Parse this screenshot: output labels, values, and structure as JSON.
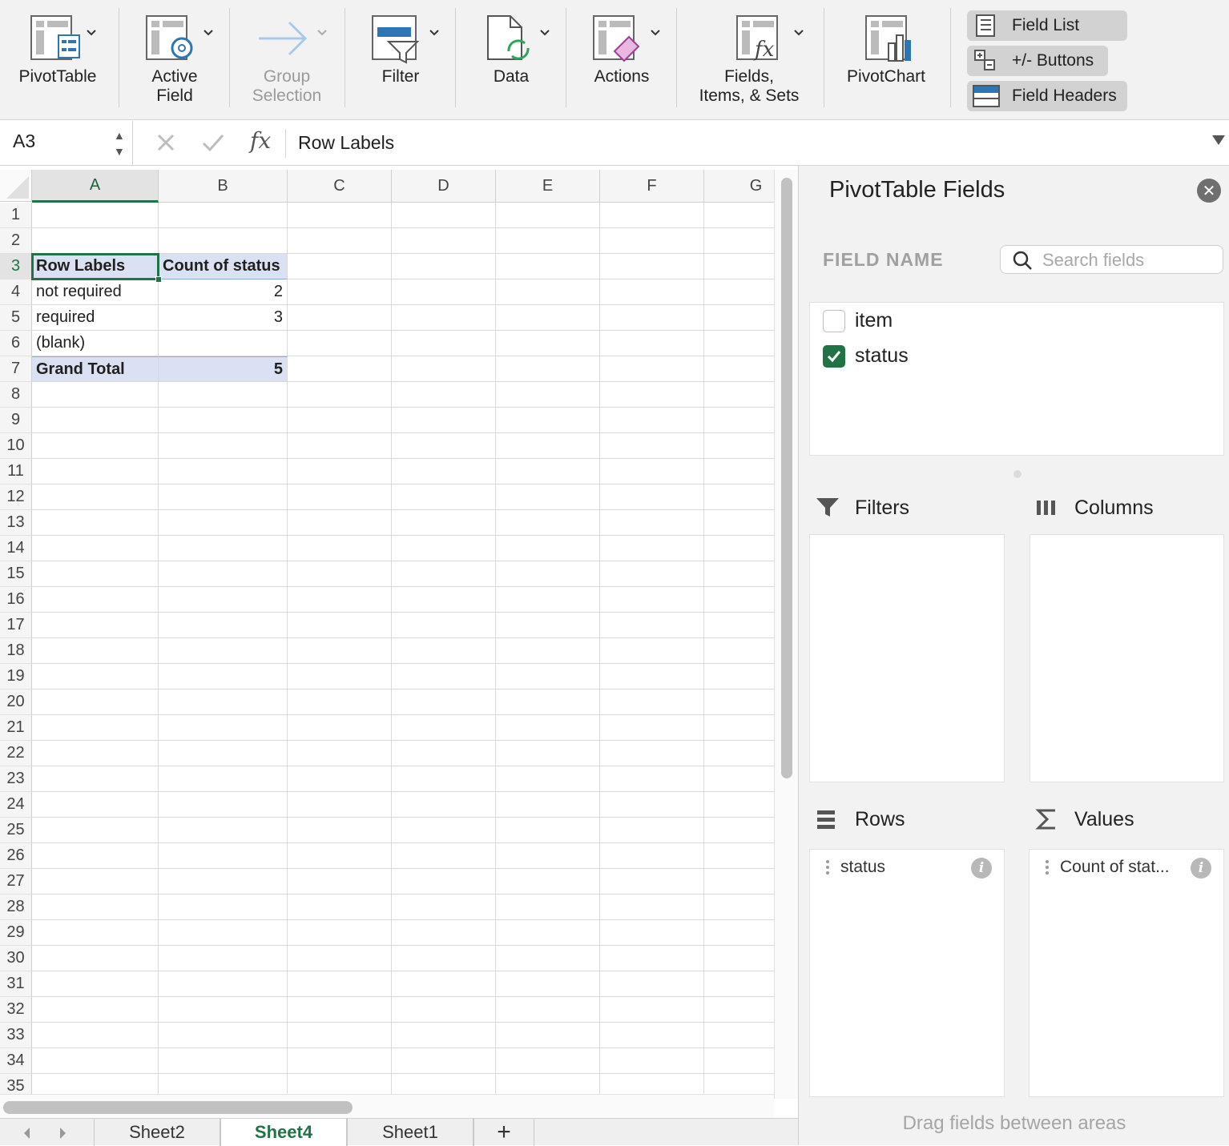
{
  "ribbon": {
    "pivottable": "PivotTable",
    "active_field_1": "Active",
    "active_field_2": "Field",
    "group_1": "Group",
    "group_2": "Selection",
    "filter": "Filter",
    "data": "Data",
    "actions": "Actions",
    "fields_1": "Fields,",
    "fields_2": "Items, & Sets",
    "pivotchart": "PivotChart",
    "field_list": "Field List",
    "buttons": "+/- Buttons",
    "field_headers": "Field Headers"
  },
  "formula_bar": {
    "cell_ref": "A3",
    "fx": "fx",
    "value": "Row Labels"
  },
  "grid": {
    "columns": [
      "A",
      "B",
      "C",
      "D",
      "E",
      "F",
      "G"
    ],
    "rows": [
      "1",
      "2",
      "3",
      "4",
      "5",
      "6",
      "7",
      "8",
      "9",
      "10",
      "11",
      "12",
      "13",
      "14",
      "15",
      "16",
      "17",
      "18",
      "19",
      "20",
      "21",
      "22",
      "23",
      "24",
      "25",
      "26",
      "27",
      "28",
      "29",
      "30",
      "31",
      "32",
      "33",
      "34",
      "35"
    ],
    "pivot": {
      "header_label": "Row Labels",
      "header_value": "Count of status",
      "rows": [
        {
          "label": "not required",
          "value": "2"
        },
        {
          "label": "required",
          "value": "3"
        },
        {
          "label": "(blank)",
          "value": ""
        }
      ],
      "total_label": "Grand Total",
      "total_value": "5"
    }
  },
  "sheet_tabs": [
    "Sheet2",
    "Sheet4",
    "Sheet1"
  ],
  "add_sheet": "+",
  "pane": {
    "title": "PivotTable Fields",
    "field_name_label": "FIELD NAME",
    "search_placeholder": "Search fields",
    "fields": [
      {
        "name": "item",
        "checked": false
      },
      {
        "name": "status",
        "checked": true
      }
    ],
    "filters_label": "Filters",
    "columns_label": "Columns",
    "rows_label": "Rows",
    "values_label": "Values",
    "rows_chip": "status",
    "values_chip": "Count of stat...",
    "hint": "Drag fields between areas"
  },
  "colors": {
    "accent": "#217346",
    "pivot_header": "#d9e1f2"
  }
}
